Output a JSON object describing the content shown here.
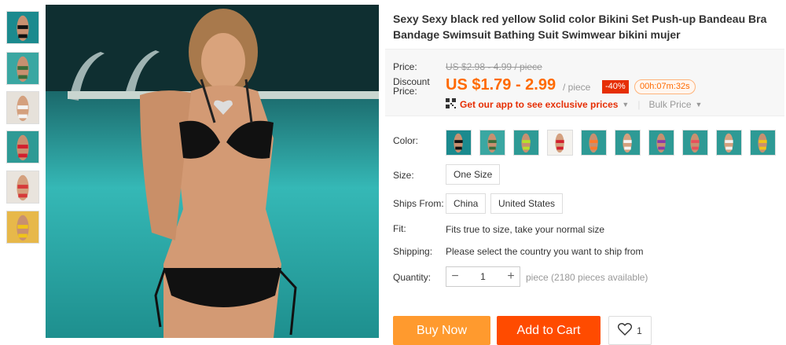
{
  "product": {
    "title": "Sexy Sexy black red yellow Solid color Bikini Set Push-up Bandeau Bra Bandage Swimsuit Bathing Suit Swimwear bikini mujer"
  },
  "price": {
    "price_label": "Price:",
    "original": "US $2.98 - 4.99 / piece",
    "discount_label": "Discount Price:",
    "current": "US $1.79 - 2.99",
    "unit": "/ piece",
    "discount_badge": "-40%",
    "countdown": "00h:07m:32s",
    "app_link": "Get our app to see exclusive prices",
    "bulk_price": "Bulk Price"
  },
  "options": {
    "color_label": "Color:",
    "size_label": "Size:",
    "size_value": "One Size",
    "ships_from_label": "Ships From:",
    "ships_from": [
      "China",
      "United States"
    ],
    "fit_label": "Fit:",
    "fit_value": "Fits true to size, take your normal size",
    "shipping_label": "Shipping:",
    "shipping_value": "Please select the country you want to ship from",
    "quantity_label": "Quantity:",
    "quantity_value": "1",
    "quantity_note": "piece (2180 pieces available)",
    "color_swatches": [
      "black",
      "green",
      "lime",
      "red",
      "orange",
      "white",
      "purple",
      "coral",
      "blue",
      "yellow"
    ]
  },
  "actions": {
    "buy_now": "Buy Now",
    "add_to_cart": "Add to Cart",
    "wishlist_count": "1"
  },
  "colors": {
    "accent": "#ff6a00",
    "buy_now": "#ff9a2e",
    "add_to_cart": "#ff4b00",
    "discount_badge": "#e62e04"
  }
}
